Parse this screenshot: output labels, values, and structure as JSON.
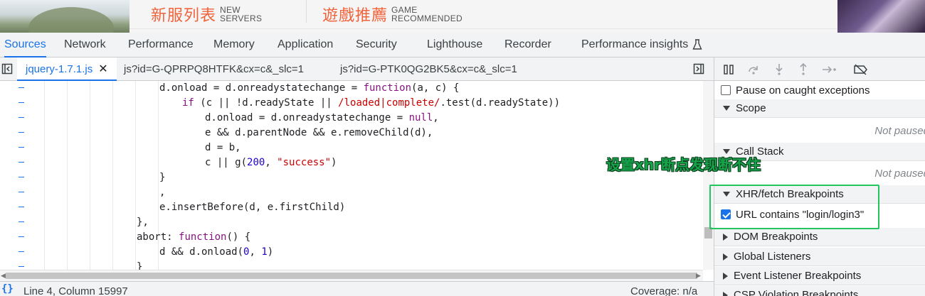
{
  "banner": {
    "promo1_cn": "新服列表",
    "promo1_en_line1": "NEW",
    "promo1_en_line2": "SERVERS",
    "promo2_cn": "遊戲推薦",
    "promo2_en_line1": "GAME",
    "promo2_en_line2": "RECOMMENDED"
  },
  "devtools_tabs": [
    {
      "label": "Sources",
      "active": true
    },
    {
      "label": "Network"
    },
    {
      "label": "Performance"
    },
    {
      "label": "Memory"
    },
    {
      "label": "Application"
    },
    {
      "label": "Security"
    },
    {
      "label": "Lighthouse"
    },
    {
      "label": "Recorder"
    },
    {
      "label": "Performance insights"
    }
  ],
  "file_tabs": [
    {
      "label": "jquery-1.7.1.js",
      "active": true,
      "closable": true
    },
    {
      "label": "js?id=G-QPRPQ8HTFK&cx=c&_slc=1"
    },
    {
      "label": "js?id=G-PTK0QG2BK5&cx=c&_slc=1"
    }
  ],
  "code_lines": [
    "d.onload = d.onreadystatechange = function(a, c) {",
    "if (c || !d.readyState || /loaded|complete/.test(d.readyState))",
    "d.onload = d.onreadystatechange = null,",
    "e && d.parentNode && e.removeChild(d),",
    "d = b,",
    "c || g(200, \"success\")",
    "}",
    ",",
    "e.insertBefore(d, e.firstChild)",
    "},",
    "abort: function() {",
    "d && d.onload(0, 1)",
    "}"
  ],
  "status": {
    "position": "Line 4, Column 15997",
    "coverage": "Coverage: n/a"
  },
  "debugger": {
    "pause_on_caught": "Pause on caught exceptions",
    "scope": "Scope",
    "not_paused": "Not paused",
    "call_stack": "Call Stack",
    "xhr_breakpoints": "XHR/fetch Breakpoints",
    "xhr_entry": "URL contains \"login/login3\"",
    "xhr_entry_checked": true,
    "dom_breakpoints": "DOM Breakpoints",
    "global_listeners": "Global Listeners",
    "event_listener_breakpoints": "Event Listener Breakpoints",
    "csp_violation_breakpoints": "CSP Violation Breakpoints"
  },
  "annotation": {
    "text": "设置xhr断点发现断不住",
    "color": "#22c55e"
  },
  "colors": {
    "accent": "#1a73e8",
    "promo": "#f0643c"
  }
}
